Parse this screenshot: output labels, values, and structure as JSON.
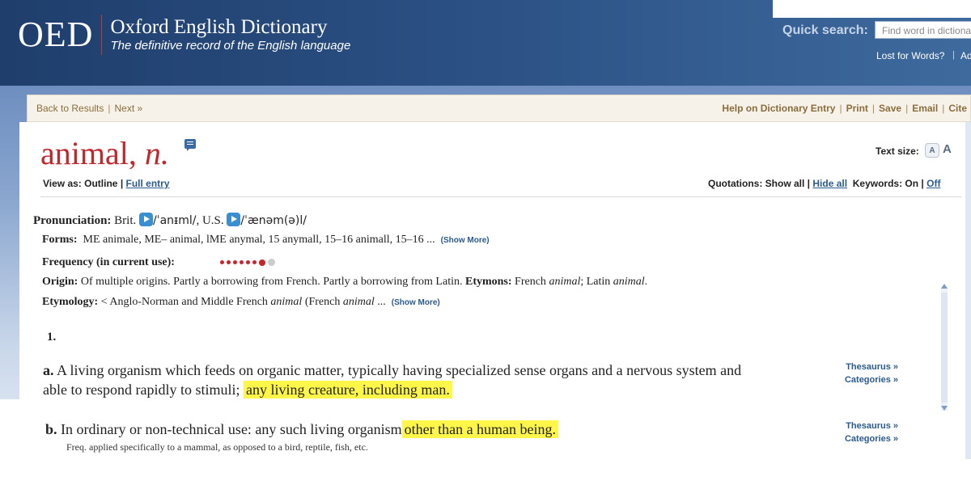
{
  "header": {
    "logo": "OED",
    "title": "Oxford English Dictionary",
    "tagline": "The definitive record of the English language",
    "quick_search_label": "Quick search:",
    "search_placeholder": "Find word in dictionary",
    "lost_for_words": "Lost for Words?",
    "separator": "|",
    "advanced_truncated": "Ad"
  },
  "toolbar": {
    "back": "Back to Results",
    "next": "Next »",
    "right_links": [
      "Help on Dictionary Entry",
      "Print",
      "Save",
      "Email",
      "Cite"
    ],
    "separator": "|"
  },
  "entry": {
    "headword": "animal,",
    "pos": "n.",
    "text_size_label": "Text size:",
    "text_size_small": "A",
    "text_size_large": "A",
    "view_as_label": "View as: Outline",
    "full_entry": "Full entry",
    "quotations_label": "Quotations: Show all",
    "hide_all": "Hide all",
    "keywords_label": "Keywords: On",
    "off": "Off",
    "pronunciation_label": "Pronunciation:",
    "brit_label": "Brit.",
    "brit_ipa": "/ˈanᵻml/",
    "us_label": ", U.S.",
    "us_ipa": "/ˈænəm(ə)l/",
    "forms_label": "Forms:",
    "forms_text": "ME animale, ME– animal, lME anymal, 15 anymall, 15–16 animall, 15–16  ...",
    "show_more": "(Show More)",
    "frequency_label": "Frequency (in current use):",
    "frequency_level": 7,
    "frequency_max": 8,
    "origin_label": "Origin:",
    "origin_text": "Of multiple origins. Partly a borrowing from French. Partly a borrowing from Latin.",
    "etymons_label": "Etymons:",
    "etymons_text_1": "French",
    "etymons_word_1": "animal",
    "etymons_text_2": "; Latin",
    "etymons_word_2": "animal",
    "etymons_end": ".",
    "etymology_label": "Etymology:",
    "etymology_text_1": "< Anglo-Norman and Middle French",
    "etymology_word_1": "animal",
    "etymology_text_2": "(French",
    "etymology_word_2": "animal",
    "etymology_end": "...",
    "sense_number": "1.",
    "sense_a_label": "a.",
    "sense_a_text": "A living organism which feeds on organic matter, typically having specialized sense organs and a nervous system and able to respond rapidly to stimuli;",
    "sense_a_highlight": "any living creature, including man.",
    "sense_b_label": "b.",
    "sense_b_text": "In ordinary or non-technical use: any such living organism",
    "sense_b_highlight": "other than a human being.",
    "sense_b_note": "Freq. applied specifically to a mammal, as opposed to a bird, reptile, fish, etc.",
    "thesaurus": "Thesaurus »",
    "categories": "Categories »"
  },
  "colors": {
    "header_blue": "#2a4f82",
    "headword_red": "#c0282d",
    "link_blue": "#2b5a8e",
    "highlight_yellow": "#fff64a",
    "toolbar_brown": "#8a6d3b"
  }
}
